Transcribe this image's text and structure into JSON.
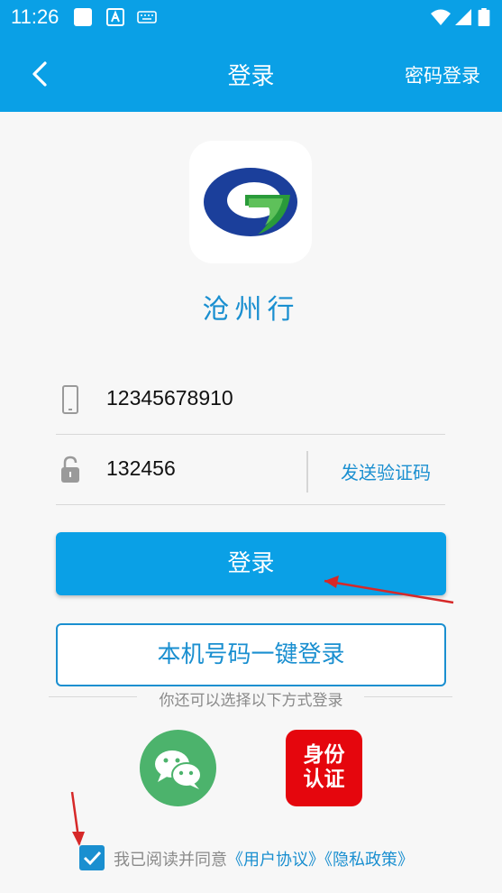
{
  "status_bar": {
    "time": "11:26"
  },
  "nav": {
    "title": "登录",
    "right_action": "密码登录"
  },
  "app": {
    "name": "沧州行"
  },
  "form": {
    "phone_value": "12345678910",
    "code_value": "132456",
    "send_code_label": "发送验证码"
  },
  "buttons": {
    "login": "登录",
    "one_key_login": "本机号码一键登录"
  },
  "alternative": {
    "hint": "你还可以选择以下方式登录",
    "id_auth_label_line1": "身份",
    "id_auth_label_line2": "认证"
  },
  "agreement": {
    "prefix": "我已阅读并同意",
    "user_agreement": "《用户协议》",
    "privacy_policy": "《隐私政策》",
    "checked": true
  },
  "colors": {
    "primary": "#0aa0e6",
    "link": "#1a8fd0",
    "wechat": "#4cb36c",
    "id_red": "#e5060d"
  }
}
